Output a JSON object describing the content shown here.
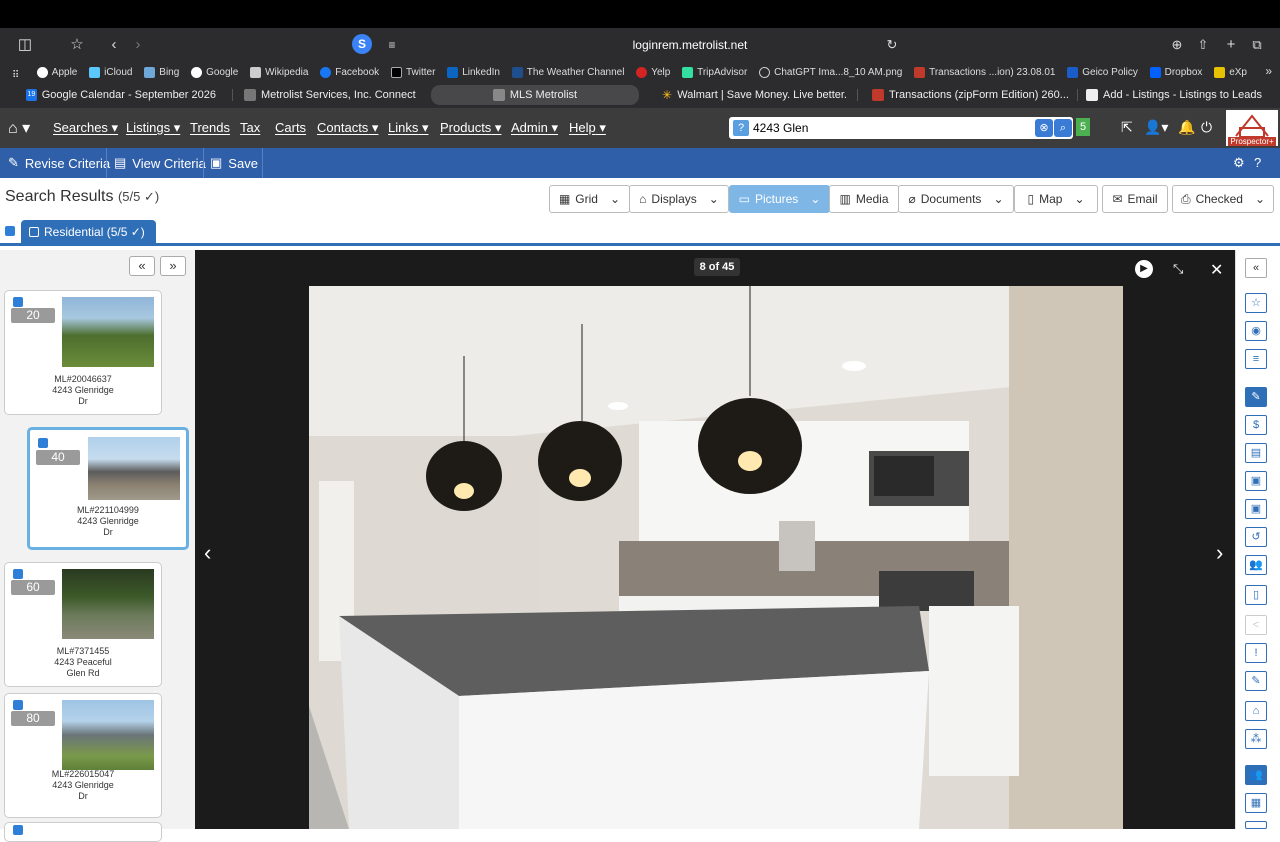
{
  "browser": {
    "url": "loginrem.metrolist.net",
    "favorites": [
      "Apple",
      "iCloud",
      "Bing",
      "Google",
      "Wikipedia",
      "Facebook",
      "Twitter",
      "LinkedIn",
      "The Weather Channel",
      "Yelp",
      "TripAdvisor",
      "ChatGPT Ima...8_10 AM.png",
      "Transactions ...ion) 23.08.01",
      "Geico Policy",
      "Dropbox",
      "eXp"
    ],
    "tabs": [
      "Google Calendar - September 2026",
      "Metrolist Services, Inc. Connect",
      "MLS Metrolist",
      "Walmart | Save Money. Live better.",
      "Transactions (zipForm Edition) 260...",
      "Add - Listings - Listings to Leads"
    ],
    "tab_day": "19"
  },
  "nav": {
    "items": [
      "Searches",
      "Listings",
      "Trends",
      "Tax",
      "Carts",
      "Contacts",
      "Links",
      "Products",
      "Admin",
      "Help"
    ],
    "search_badge": "?",
    "search_value": "4243 Glen",
    "count_badge": "5",
    "logo_text": "Prospector+"
  },
  "actionbar": {
    "revise": "Revise Criteria",
    "view": "View Criteria",
    "save": "Save"
  },
  "results": {
    "title": "Search Results",
    "count": "(5/5 ✓)",
    "tab_label": "Residential",
    "tab_count": "(5/5 ✓)",
    "views": [
      "Grid",
      "Displays",
      "Pictures",
      "Media",
      "Documents",
      "Map",
      "Email",
      "Checked"
    ]
  },
  "listings": [
    {
      "badge": "20",
      "ml": "ML#20046637",
      "addr1": "4243 Glenridge",
      "addr2": "Dr"
    },
    {
      "badge": "40",
      "ml": "ML#221104999",
      "addr1": "4243 Glenridge",
      "addr2": "Dr"
    },
    {
      "badge": "60",
      "ml": "ML#7371455",
      "addr1": "4243 Peaceful",
      "addr2": "Glen Rd"
    },
    {
      "badge": "80",
      "ml": "ML#226015047",
      "addr1": "4243 Glenridge",
      "addr2": "Dr"
    }
  ],
  "viewer": {
    "counter": "8 of 45"
  },
  "colors": {
    "nav_bg": "#3c3c3c",
    "action_bg": "#2f5fa8",
    "accent": "#7eb6e6",
    "viewer_bg": "#1b1b1b"
  }
}
